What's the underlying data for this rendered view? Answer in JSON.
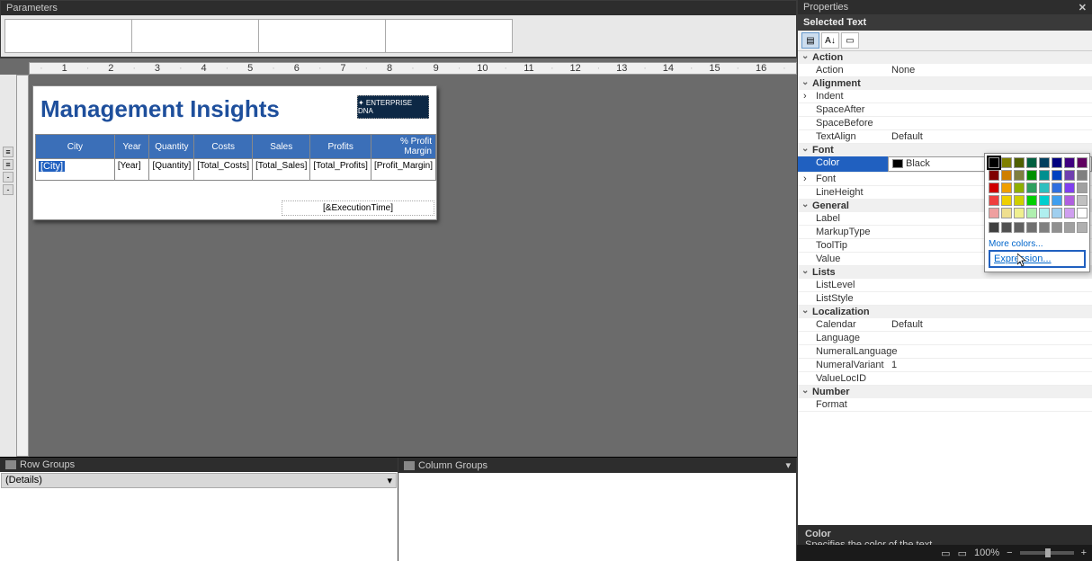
{
  "panels": {
    "parameters_title": "Parameters",
    "properties_title": "Properties",
    "selected_text": "Selected Text",
    "row_groups": "Row Groups",
    "column_groups": "Column Groups",
    "details_item": "(Details)"
  },
  "report": {
    "title": "Management Insights",
    "logo_text": "✦ ENTERPRISE DNA",
    "headers": [
      "City",
      "Year",
      "Quantity",
      "Costs",
      "Sales",
      "Profits",
      "% Profit Margin"
    ],
    "cells": [
      "[City]",
      "[Year]",
      "[Quantity]",
      "[Total_Costs]",
      "[Total_Sales]",
      "[Total_Profits]",
      "[Profit_Margin]"
    ],
    "exec_time": "[&ExecutionTime]"
  },
  "ruler": [
    "",
    "1",
    "",
    "2",
    "",
    "3",
    "",
    "4",
    "",
    "5",
    "",
    "6",
    "",
    "7",
    "",
    "8",
    "",
    "9",
    "",
    "10",
    "",
    "11",
    "",
    "12",
    "",
    "13",
    "",
    "14",
    "",
    "15",
    "",
    "16",
    ""
  ],
  "props": {
    "categories": [
      {
        "name": "Action",
        "rows": [
          {
            "n": "Action",
            "v": "None"
          }
        ]
      },
      {
        "name": "Alignment",
        "rows": [
          {
            "n": "Indent",
            "v": "",
            "expand": true
          },
          {
            "n": "SpaceAfter",
            "v": ""
          },
          {
            "n": "SpaceBefore",
            "v": ""
          },
          {
            "n": "TextAlign",
            "v": "Default"
          }
        ]
      },
      {
        "name": "Font",
        "rows": [
          {
            "n": "Color",
            "v": "Black",
            "selected": true,
            "swatch": true
          },
          {
            "n": "Font",
            "v": "",
            "expand": true
          },
          {
            "n": "LineHeight",
            "v": ""
          }
        ]
      },
      {
        "name": "General",
        "rows": [
          {
            "n": "Label",
            "v": ""
          },
          {
            "n": "MarkupType",
            "v": ""
          },
          {
            "n": "ToolTip",
            "v": ""
          },
          {
            "n": "Value",
            "v": ""
          }
        ]
      },
      {
        "name": "Lists",
        "rows": [
          {
            "n": "ListLevel",
            "v": ""
          },
          {
            "n": "ListStyle",
            "v": ""
          }
        ]
      },
      {
        "name": "Localization",
        "rows": [
          {
            "n": "Calendar",
            "v": "Default"
          },
          {
            "n": "Language",
            "v": ""
          },
          {
            "n": "NumeralLanguage",
            "v": ""
          },
          {
            "n": "NumeralVariant",
            "v": "1"
          },
          {
            "n": "ValueLocID",
            "v": ""
          }
        ]
      },
      {
        "name": "Number",
        "rows": [
          {
            "n": "Format",
            "v": ""
          }
        ]
      }
    ]
  },
  "color_popup": {
    "more_colors": "More colors...",
    "expression": "Expression...",
    "colors_r1": [
      "#000000",
      "#7f7f00",
      "#4f5f00",
      "#005f3f",
      "#003f5f",
      "#00007f",
      "#3f007f",
      "#5f005f"
    ],
    "colors_r2": [
      "#7f0000",
      "#cf7f00",
      "#7f7f3f",
      "#008f00",
      "#008f8f",
      "#0040c0",
      "#6f3faf",
      "#808080"
    ],
    "colors_r3": [
      "#cf0000",
      "#ef9f00",
      "#8faf00",
      "#2f9f5f",
      "#2fbfbf",
      "#2f6fdf",
      "#7f3fef",
      "#a0a0a0"
    ],
    "colors_r4": [
      "#ef3f3f",
      "#efcf00",
      "#cfcf00",
      "#00cf00",
      "#00cfcf",
      "#3f9fef",
      "#af5fdf",
      "#c0c0c0"
    ],
    "colors_r5": [
      "#ef9f9f",
      "#efdf8f",
      "#efef8f",
      "#afefaf",
      "#afefef",
      "#9fcfef",
      "#cf9fef",
      "#ffffff"
    ],
    "grays": [
      "#404040",
      "#505050",
      "#606060",
      "#707070",
      "#808080",
      "#909090",
      "#a0a0a0",
      "#b0b0b0"
    ]
  },
  "desc": {
    "title": "Color",
    "text": "Specifies the color of the text."
  },
  "status": {
    "zoom": "100%"
  }
}
